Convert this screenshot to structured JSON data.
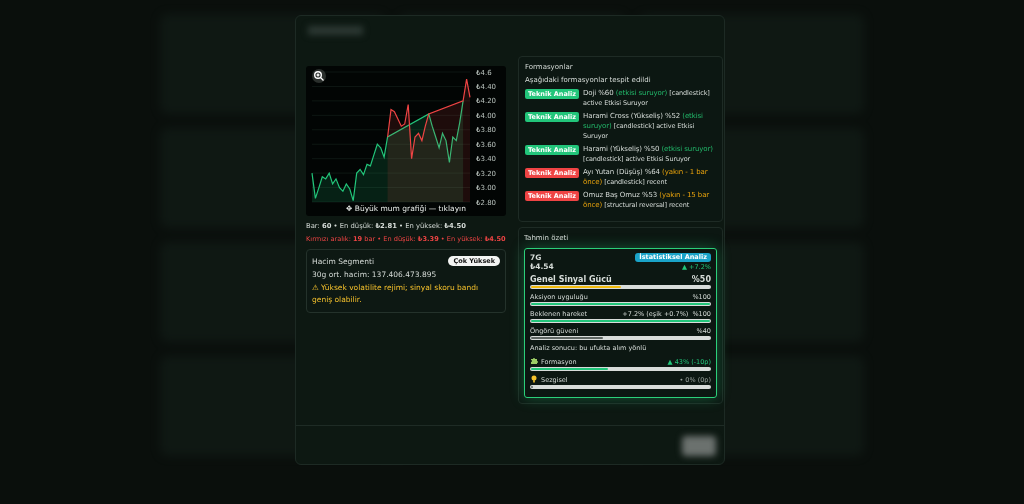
{
  "chart": {
    "caption": "✥ Büyük mum grafiği — tıklayın",
    "chart_data": {
      "type": "area",
      "grid": true,
      "yticks": [
        {
          "value": 2.8,
          "label": "₺2.80"
        },
        {
          "value": 3.0,
          "label": "₺3.00"
        },
        {
          "value": 3.2,
          "label": "₺3.20"
        },
        {
          "value": 3.4,
          "label": "₺3.40"
        },
        {
          "value": 3.6,
          "label": "₺3.60"
        },
        {
          "value": 3.8,
          "label": "₺3.80"
        },
        {
          "value": 4.0,
          "label": "₺4.00"
        },
        {
          "value": 4.2,
          "label": "₺4.20"
        },
        {
          "value": 4.4,
          "label": "₺4.40"
        },
        {
          "value": 4.6,
          "label": "₺4.6"
        }
      ],
      "ylim": [
        2.8,
        4.6
      ],
      "series": [
        {
          "color": "#22c57a",
          "values": [
            3.2,
            2.85,
            3.0,
            3.15,
            3.12,
            3.2,
            3.05,
            3.12,
            3.0,
            2.95,
            3.05,
            2.98,
            2.82,
            3.2,
            3.25,
            3.18,
            3.32,
            3.3,
            3.45,
            3.6,
            3.55,
            3.42,
            3.7,
            null,
            null,
            null,
            null,
            null,
            null,
            null,
            null,
            null,
            null,
            null,
            4.02,
            3.85,
            3.7,
            3.55,
            3.75,
            3.65,
            3.35,
            3.7,
            3.65,
            3.9,
            4.2,
            null,
            null
          ]
        },
        {
          "color": "#ef4444",
          "values": [
            null,
            null,
            null,
            null,
            null,
            null,
            null,
            null,
            null,
            null,
            null,
            null,
            null,
            null,
            null,
            null,
            null,
            null,
            null,
            null,
            null,
            null,
            3.7,
            4.08,
            4.05,
            3.95,
            3.85,
            3.88,
            4.15,
            3.4,
            3.7,
            3.75,
            3.65,
            3.85,
            4.02,
            null,
            null,
            null,
            null,
            null,
            null,
            null,
            null,
            null,
            4.2,
            4.5,
            4.25
          ]
        }
      ]
    }
  },
  "stats": "Bar: **60** • En düşük: **₺2.81** • En yüksek: **₺4.50**",
  "red_stats": "Kırmızı aralık: **19** bar • En düşük: **₺3.39** • En yüksek: **₺4.50**",
  "volume": {
    "title": "Hacim Segmenti",
    "badge": "Çok Yüksek",
    "average": "30g ort. hacim: 137.406.473.895",
    "warning": "⚠ Yüksek volatilite rejimi; sinyal skoru bandı geniş olabilir."
  },
  "formations": {
    "title": "Formasyonlar",
    "subtitle": "Aşağıdaki formasyonlar tespit edildi",
    "items": [
      {
        "badge": "Teknik Analiz",
        "color": "#22c57a",
        "name": "Doji %60",
        "note": "(etkisi suruyor)",
        "kind": "active",
        "detail": "[candlestick] active Etkisi Suruyor"
      },
      {
        "badge": "Teknik Analiz",
        "color": "#22c57a",
        "name": "Harami Cross (Yükseliş) %52",
        "note": "(etkisi suruyor)",
        "kind": "active",
        "detail": "[candlestick] active Etkisi Suruyor"
      },
      {
        "badge": "Teknik Analiz",
        "color": "#22c57a",
        "name": "Harami (Yükseliş) %50",
        "note": "(etkisi suruyor)",
        "kind": "active",
        "detail": "[candlestick] active Etkisi Suruyor"
      },
      {
        "badge": "Teknik Analiz",
        "color": "#ef4444",
        "name": "Ayı Yutan (Düşüş) %64",
        "note": "(yakın - 1 bar önce)",
        "kind": "recent",
        "detail": "[candlestick] recent"
      },
      {
        "badge": "Teknik Analiz",
        "color": "#ef4444",
        "name": "Omuz Baş Omuz %53",
        "note": "(yakın - 15 bar önce)",
        "kind": "recent",
        "detail": "[structural reversal] recent"
      }
    ]
  },
  "forecast": {
    "title": "Tahmin özeti",
    "horizon": "7G",
    "badge": "İstatistiksel Analiz",
    "price": "₺4.54",
    "change": "▲ +7.2%",
    "signal": {
      "label": "Genel Sinyal Gücü",
      "value": "%50",
      "level": 0.5
    },
    "metrics": [
      {
        "label": "Aksiyon uyguluğu",
        "value": "%100",
        "level": 1,
        "kind": "good"
      },
      {
        "label": "Beklenen hareket",
        "extra": "+7.2% (eşik +0.7%)",
        "value": "%100",
        "level": 1,
        "kind": "good"
      },
      {
        "label": "Öngörü güveni",
        "value": "%40",
        "level": 0.4,
        "kind": "neutral"
      }
    ],
    "conclusion": "Analiz sonucu: bu ufukta alım yönlü",
    "factors": [
      {
        "label": "Formasyon",
        "value": "▲ 43% (-10p)",
        "level": 0.43,
        "kind": "good"
      },
      {
        "label": "Sezgisel",
        "value": "• 0% (0p)",
        "level": 0,
        "kind": "neutral"
      }
    ]
  }
}
